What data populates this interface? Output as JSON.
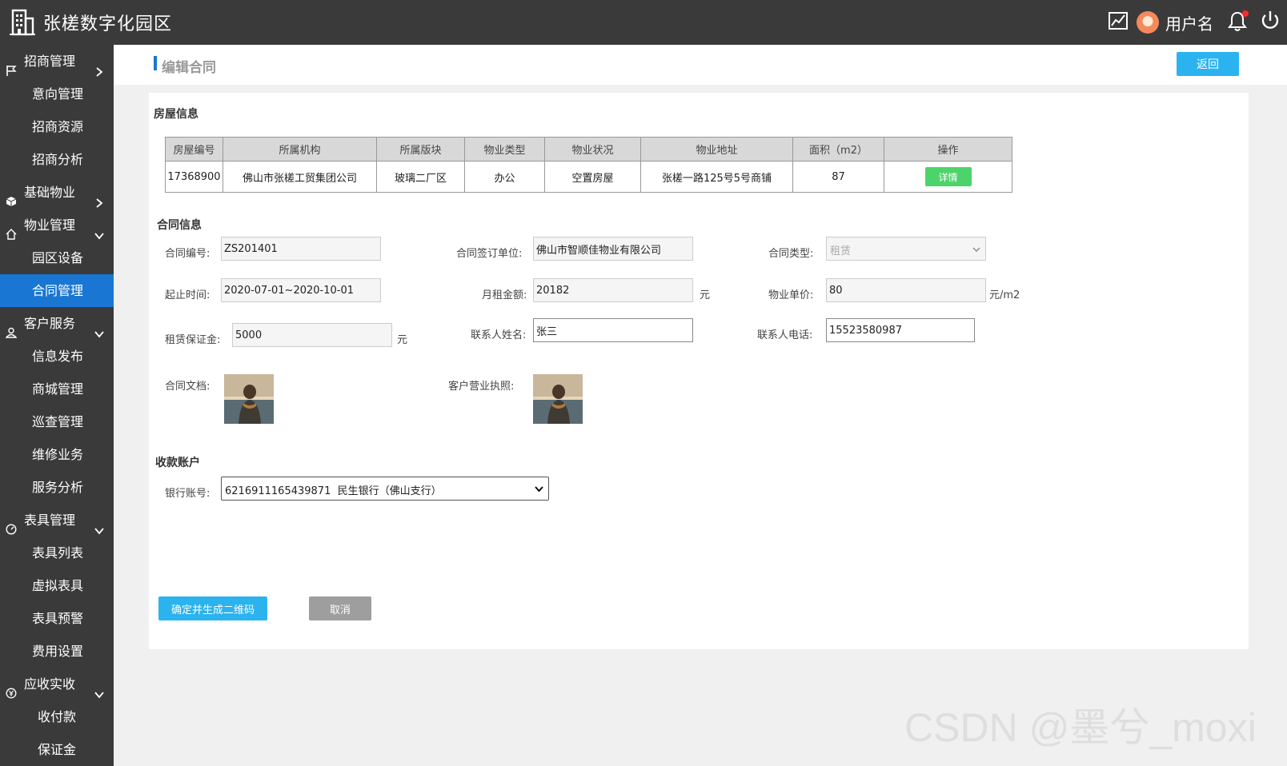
{
  "app": {
    "title": "张槎数字化园区"
  },
  "header": {
    "username": "用户名"
  },
  "sidebar": {
    "items": [
      {
        "label": "招商管理",
        "type": "parent",
        "expanded": false
      },
      {
        "label": "意向管理",
        "type": "child"
      },
      {
        "label": "招商资源",
        "type": "child"
      },
      {
        "label": "招商分析",
        "type": "child"
      },
      {
        "label": "基础物业",
        "type": "parent",
        "expanded": false
      },
      {
        "label": "物业管理",
        "type": "parent",
        "expanded": true
      },
      {
        "label": "园区设备",
        "type": "child"
      },
      {
        "label": "合同管理",
        "type": "child",
        "active": true
      },
      {
        "label": "客户服务",
        "type": "parent",
        "expanded": true
      },
      {
        "label": "信息发布",
        "type": "child"
      },
      {
        "label": "商城管理",
        "type": "child"
      },
      {
        "label": "巡查管理",
        "type": "child"
      },
      {
        "label": "维修业务",
        "type": "child"
      },
      {
        "label": "服务分析",
        "type": "child"
      },
      {
        "label": "表具管理",
        "type": "parent",
        "expanded": true
      },
      {
        "label": "表具列表",
        "type": "child"
      },
      {
        "label": "虚拟表具",
        "type": "child"
      },
      {
        "label": "表具预警",
        "type": "child"
      },
      {
        "label": "费用设置",
        "type": "child"
      },
      {
        "label": "应收实收",
        "type": "parent",
        "expanded": true
      },
      {
        "label": "收付款",
        "type": "child"
      },
      {
        "label": "保证金",
        "type": "child"
      }
    ]
  },
  "page": {
    "title": "编辑合同",
    "back_label": "返回"
  },
  "house_info": {
    "section_title": "房屋信息",
    "columns": [
      "房屋编号",
      "所属机构",
      "所属版块",
      "物业类型",
      "物业状况",
      "物业地址",
      "面积（m2）",
      "操作"
    ],
    "rows": [
      {
        "cells": [
          "17368900",
          "佛山市张槎工贸集团公司",
          "玻璃二厂区",
          "办公",
          "空置房屋",
          "张槎一路125号5号商铺",
          "87"
        ],
        "action_label": "详情"
      }
    ]
  },
  "contract": {
    "section_title": "合同信息",
    "contract_no": {
      "label": "合同编号:",
      "value": "ZS201401"
    },
    "signing_unit": {
      "label": "合同签订单位:",
      "value": "佛山市智顺佳物业有限公司"
    },
    "contract_type": {
      "label": "合同类型:",
      "value": "租赁"
    },
    "period": {
      "label": "起止时间:",
      "value": "2020-07-01~2020-10-01"
    },
    "monthly_rent": {
      "label": "月租金额:",
      "value": "20182",
      "unit": "元"
    },
    "unit_price": {
      "label": "物业单价:",
      "value": "80",
      "unit": "元/m2"
    },
    "deposit": {
      "label": "租赁保证金:",
      "value": "5000",
      "unit": "元"
    },
    "contact_name": {
      "label": "联系人姓名:",
      "value": "张三"
    },
    "contact_phone": {
      "label": "联系人电话:",
      "value": "15523580987"
    },
    "contract_doc": {
      "label": "合同文档:"
    },
    "business_license": {
      "label": "客户营业执照:"
    }
  },
  "account": {
    "section_title": "收款账户",
    "bank": {
      "label": "银行账号:",
      "value": "6216911165439871  民生银行（佛山支行）"
    }
  },
  "actions": {
    "confirm_label": "确定并生成二维码",
    "cancel_label": "取消"
  },
  "watermark": "CSDN @墨兮_moxi",
  "colors": {
    "header_bg": "#3a3a3a",
    "active": "#1976d2",
    "primary": "#2bb3f0",
    "success": "#4cd46a",
    "notify_dot": "#ff2a2a"
  }
}
